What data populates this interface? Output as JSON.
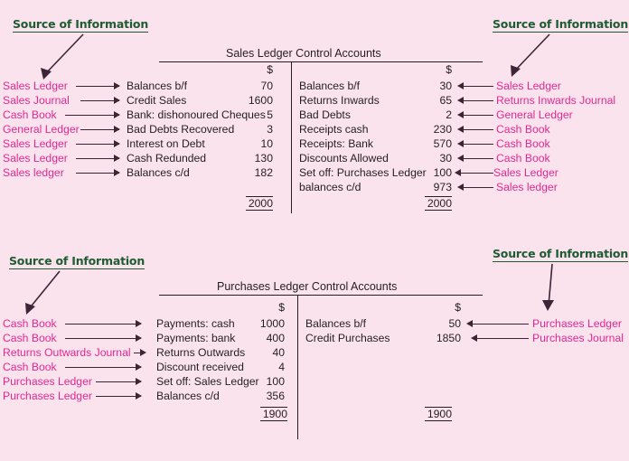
{
  "page": {
    "background_color": "#fbe3ee",
    "source_caption": "Source of Information",
    "source_caption_color": "#1d5c33",
    "label_color": "#e5288f",
    "ink_color": "#231f20"
  },
  "captions": {
    "top_left": "Source of Information",
    "top_right": "Source of Information",
    "bottom_left": "Source of Information",
    "bottom_right": "Source of Information"
  },
  "accounts": [
    {
      "id": "sales-ledger-control-account",
      "title": "Sales Ledger Control Accounts",
      "currency_symbol": "$",
      "debit": {
        "rows": [
          {
            "source": "Sales Ledger",
            "particular": "Balances b/f",
            "amount": "70"
          },
          {
            "source": "Sales Journal",
            "particular": "Credit Sales",
            "amount": "1600"
          },
          {
            "source": "Cash Book",
            "particular": "Bank: dishonoured Cheques",
            "amount": "5"
          },
          {
            "source": "General Ledger",
            "particular": "Bad Debts Recovered",
            "amount": "3"
          },
          {
            "source": "Sales Ledger",
            "particular": "Interest on Debt",
            "amount": "10"
          },
          {
            "source": "Sales Ledger",
            "particular": "Cash Redunded",
            "amount": "130"
          },
          {
            "source": "Sales ledger",
            "particular": "Balances c/d",
            "amount": "182"
          }
        ],
        "total": "2000"
      },
      "credit": {
        "rows": [
          {
            "particular": "Balances b/f",
            "amount": "30",
            "source": "Sales Ledger"
          },
          {
            "particular": "Returns Inwards",
            "amount": "65",
            "source": "Returns Inwards Journal"
          },
          {
            "particular": "Bad Debts",
            "amount": "2",
            "source": "General Ledger"
          },
          {
            "particular": "Receipts cash",
            "amount": "230",
            "source": "Cash Book"
          },
          {
            "particular": "Receipts: Bank",
            "amount": "570",
            "source": "Cash Book"
          },
          {
            "particular": "Discounts Allowed",
            "amount": "30",
            "source": "Cash Book"
          },
          {
            "particular": "Set off: Purchases Ledger",
            "amount": "100",
            "source": "Sales Ledger"
          },
          {
            "particular": "balances c/d",
            "amount": "973",
            "source": "Sales ledger"
          }
        ],
        "total": "2000"
      }
    },
    {
      "id": "purchases-ledger-control-account",
      "title": "Purchases  Ledger Control Accounts",
      "currency_symbol": "$",
      "debit": {
        "rows": [
          {
            "source": "Cash Book",
            "particular": "Payments: cash",
            "amount": "1000"
          },
          {
            "source": "Cash Book",
            "particular": "Payments: bank",
            "amount": "400"
          },
          {
            "source": "Returns Outwards Journal",
            "particular": "Returns Outwards",
            "amount": "40"
          },
          {
            "source": "Cash Book",
            "particular": "Discount received",
            "amount": "4"
          },
          {
            "source": "Purchases Ledger",
            "particular": "Set off: Sales Ledger",
            "amount": "100"
          },
          {
            "source": "Purchases Ledger",
            "particular": "Balances c/d",
            "amount": "356"
          }
        ],
        "total": "1900"
      },
      "credit": {
        "rows": [
          {
            "particular": "Balances b/f",
            "amount": "50",
            "source": "Purchases Ledger"
          },
          {
            "particular": "Credit Purchases",
            "amount": "1850",
            "source": "Purchases Journal"
          }
        ],
        "total": "1900"
      }
    }
  ]
}
